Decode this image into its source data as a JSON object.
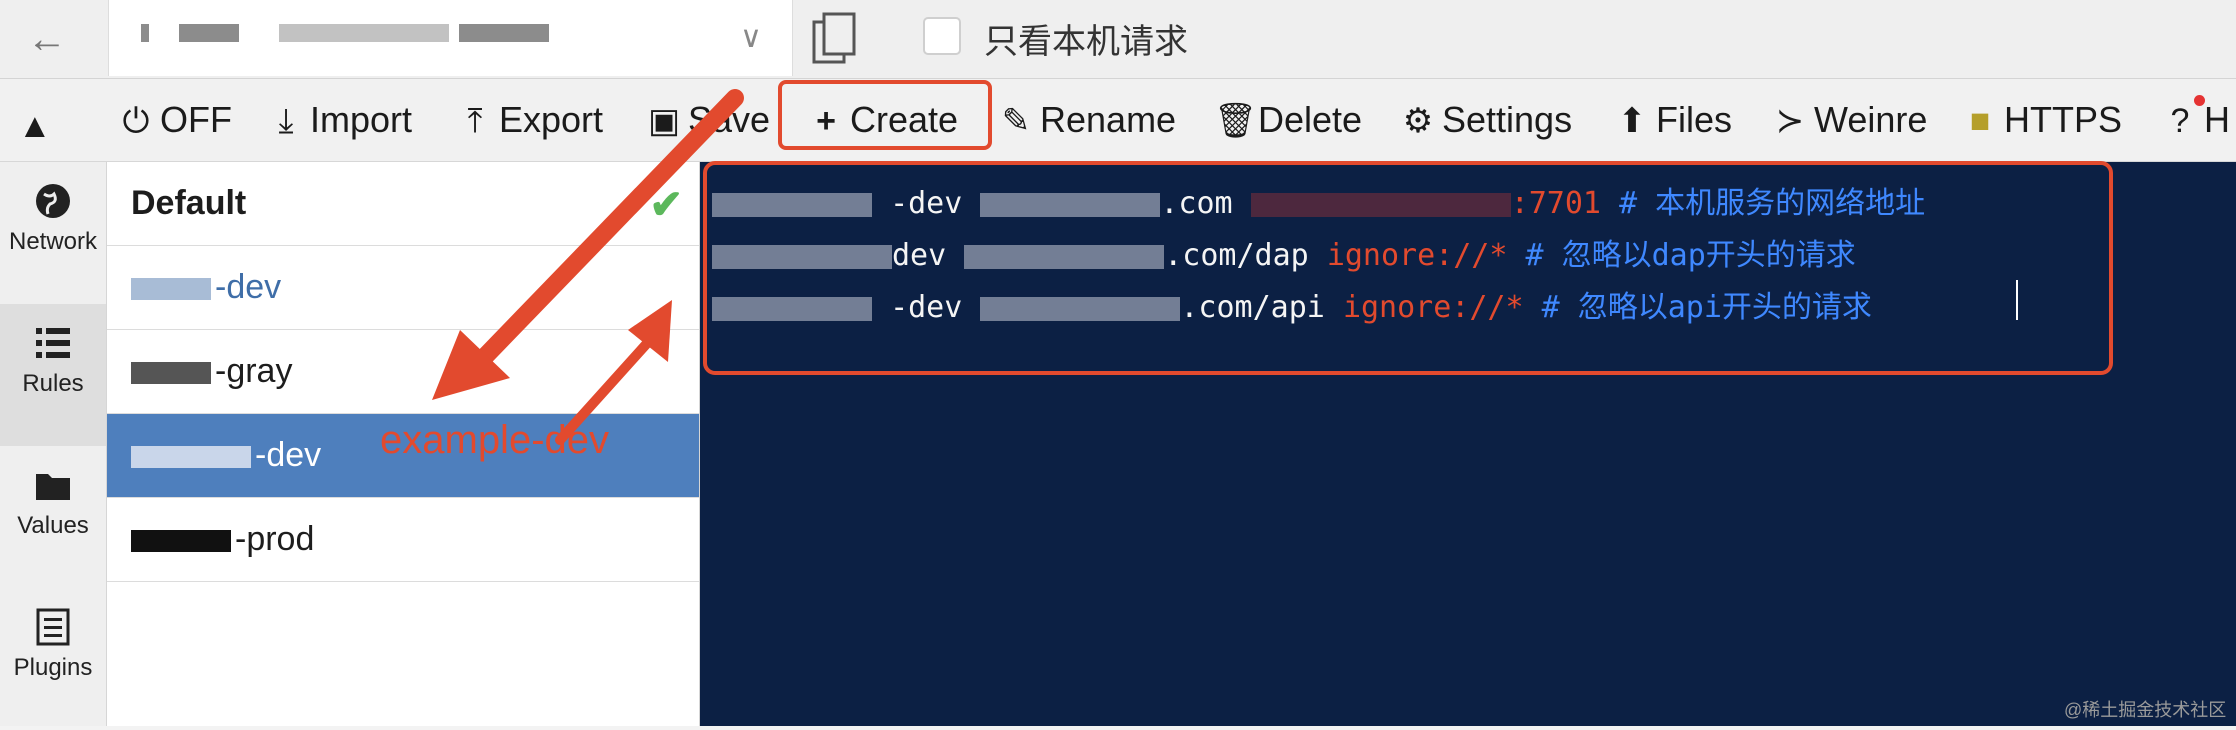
{
  "topbar": {
    "only_local_label": "只看本机请求"
  },
  "toolbar": {
    "items": [
      {
        "icon": "power-icon",
        "label": "OFF"
      },
      {
        "icon": "import-icon",
        "label": "Import"
      },
      {
        "icon": "export-icon",
        "label": "Export"
      },
      {
        "icon": "save-icon",
        "label": "Save"
      },
      {
        "icon": "plus-icon",
        "label": "Create"
      },
      {
        "icon": "rename-icon",
        "label": "Rename"
      },
      {
        "icon": "trash-icon",
        "label": "Delete"
      },
      {
        "icon": "gear-icon",
        "label": "Settings"
      },
      {
        "icon": "upload-icon",
        "label": "Files"
      },
      {
        "icon": "terminal-icon",
        "label": "Weinre"
      },
      {
        "icon": "lock-icon",
        "label": "HTTPS"
      },
      {
        "icon": "help-icon",
        "label": "H"
      }
    ]
  },
  "nav": [
    {
      "label": "Network",
      "icon": "globe-icon"
    },
    {
      "label": "Rules",
      "icon": "list-icon",
      "active": true
    },
    {
      "label": "Values",
      "icon": "folder-icon"
    },
    {
      "label": "Plugins",
      "icon": "plugin-icon"
    }
  ],
  "rules": {
    "items": [
      {
        "label": "Default"
      },
      {
        "label": "-dev"
      },
      {
        "label": "-gray"
      },
      {
        "label": "-dev",
        "selected": true
      },
      {
        "label": "-prod"
      }
    ]
  },
  "editor": {
    "lines": [
      {
        "seg1": "-dev",
        "seg2": ".com",
        "seg3": ":7701",
        "comment": "# 本机服务的网络地址"
      },
      {
        "seg1": "dev",
        "seg2": ".com/dap",
        "seg3": "ignore://*",
        "comment": "# 忽略以dap开头的请求"
      },
      {
        "seg1": "-dev",
        "seg2": ".com/api",
        "seg3": "ignore://*",
        "comment": "# 忽略以api开头的请求"
      }
    ]
  },
  "annotation": {
    "text": "example-dev"
  },
  "watermark": "@稀土掘金技术社区",
  "colors": {
    "accent_red": "#e24a2e",
    "editor_bg": "#0c2044",
    "selected_row": "#4e7fbd"
  }
}
